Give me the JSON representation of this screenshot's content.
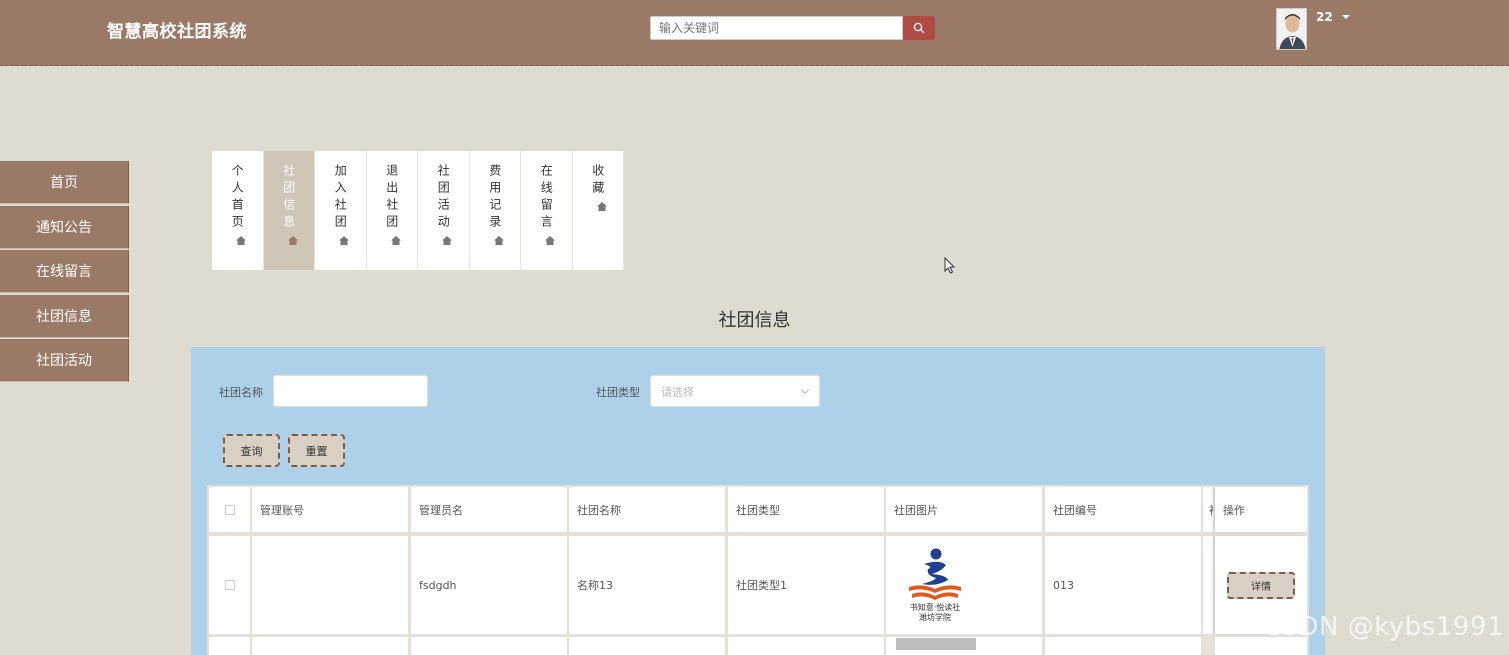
{
  "header": {
    "brand": "智慧高校社团系统",
    "search_placeholder": "输入关键词",
    "user_name": "22"
  },
  "sidebar": {
    "items": [
      {
        "label": "首页"
      },
      {
        "label": "通知公告"
      },
      {
        "label": "在线留言"
      },
      {
        "label": "社团信息"
      },
      {
        "label": "社团活动"
      }
    ]
  },
  "tabs": [
    {
      "label": "个人首页",
      "active": false
    },
    {
      "label": "社团信息",
      "active": true
    },
    {
      "label": "加入社团",
      "active": false
    },
    {
      "label": "退出社团",
      "active": false
    },
    {
      "label": "社团活动",
      "active": false
    },
    {
      "label": "费用记录",
      "active": false
    },
    {
      "label": "在线留言",
      "active": false
    },
    {
      "label": "收藏",
      "active": false
    }
  ],
  "page_title": "社团信息",
  "filters": {
    "name_label": "社团名称",
    "name_value": "",
    "type_label": "社团类型",
    "type_placeholder": "请选择",
    "query_button": "查询",
    "reset_button": "重置"
  },
  "table": {
    "headers": [
      "管理账号",
      "管理员名",
      "社团名称",
      "社团类型",
      "社团图片",
      "社团编号",
      "社",
      "操作"
    ],
    "rows": [
      {
        "account": "",
        "admin_name": "fsdgdh",
        "club_name": "名称13",
        "club_type": "社团类型1",
        "image_caption_1": "书知意·悦读社",
        "image_caption_2": "潍坊学院",
        "club_no": "013",
        "action": "详情"
      }
    ]
  },
  "watermark": "CSDN @kybs1991",
  "colors": {
    "header_bg": "#9a7a66",
    "page_bg": "#dedcd1",
    "panel_bg": "#add1e8",
    "search_button": "#b04a45",
    "button_bg": "#d9cfc2"
  }
}
